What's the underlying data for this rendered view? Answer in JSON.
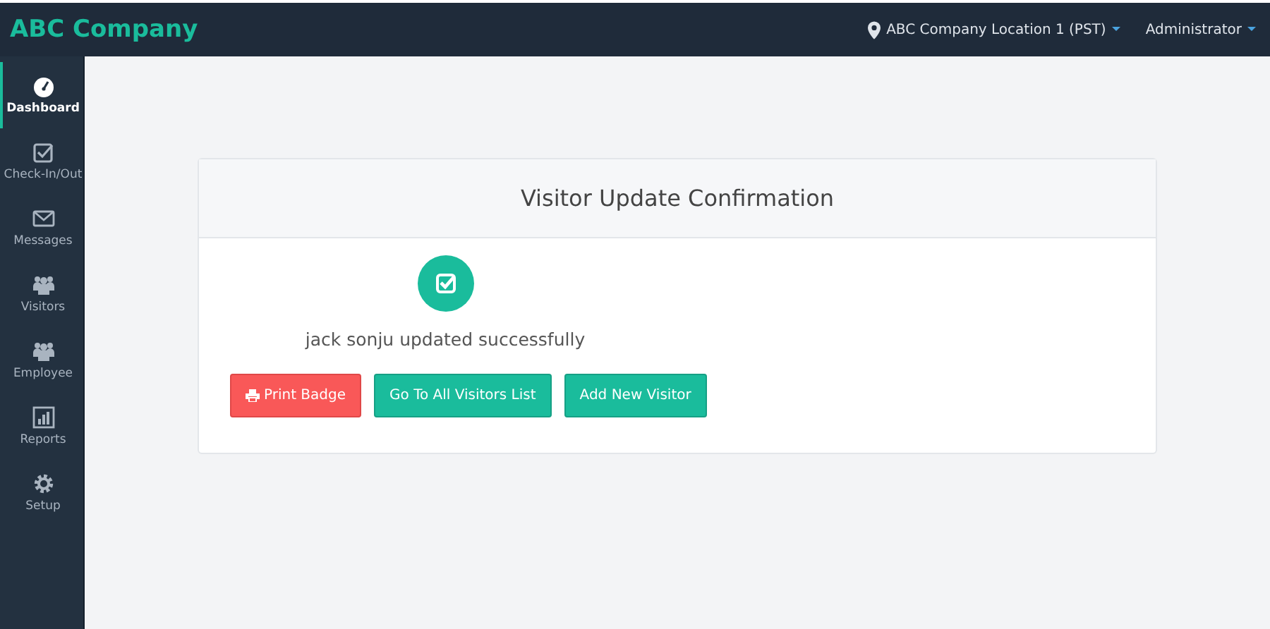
{
  "brand": "ABC Company",
  "header": {
    "location": "ABC Company Location 1 (PST)",
    "user": "Administrator"
  },
  "sidebar": {
    "items": [
      {
        "label": "Dashboard",
        "kind": "gauge",
        "selected": true
      },
      {
        "label": "Check-In/Out",
        "kind": "check",
        "selected": false
      },
      {
        "label": "Messages",
        "kind": "mail",
        "selected": false
      },
      {
        "label": "Visitors",
        "kind": "users",
        "selected": false
      },
      {
        "label": "Employee",
        "kind": "users",
        "selected": false
      },
      {
        "label": "Reports",
        "kind": "chart",
        "selected": false
      },
      {
        "label": "Setup",
        "kind": "gear",
        "selected": false
      }
    ]
  },
  "card": {
    "title": "Visitor Update Confirmation",
    "message": "jack sonju updated successfully",
    "buttons": [
      {
        "label": "Print Badge",
        "kind": "danger"
      },
      {
        "label": "Go To All Visitors List",
        "kind": "primary"
      },
      {
        "label": "Add New Visitor",
        "kind": "primary"
      }
    ]
  }
}
